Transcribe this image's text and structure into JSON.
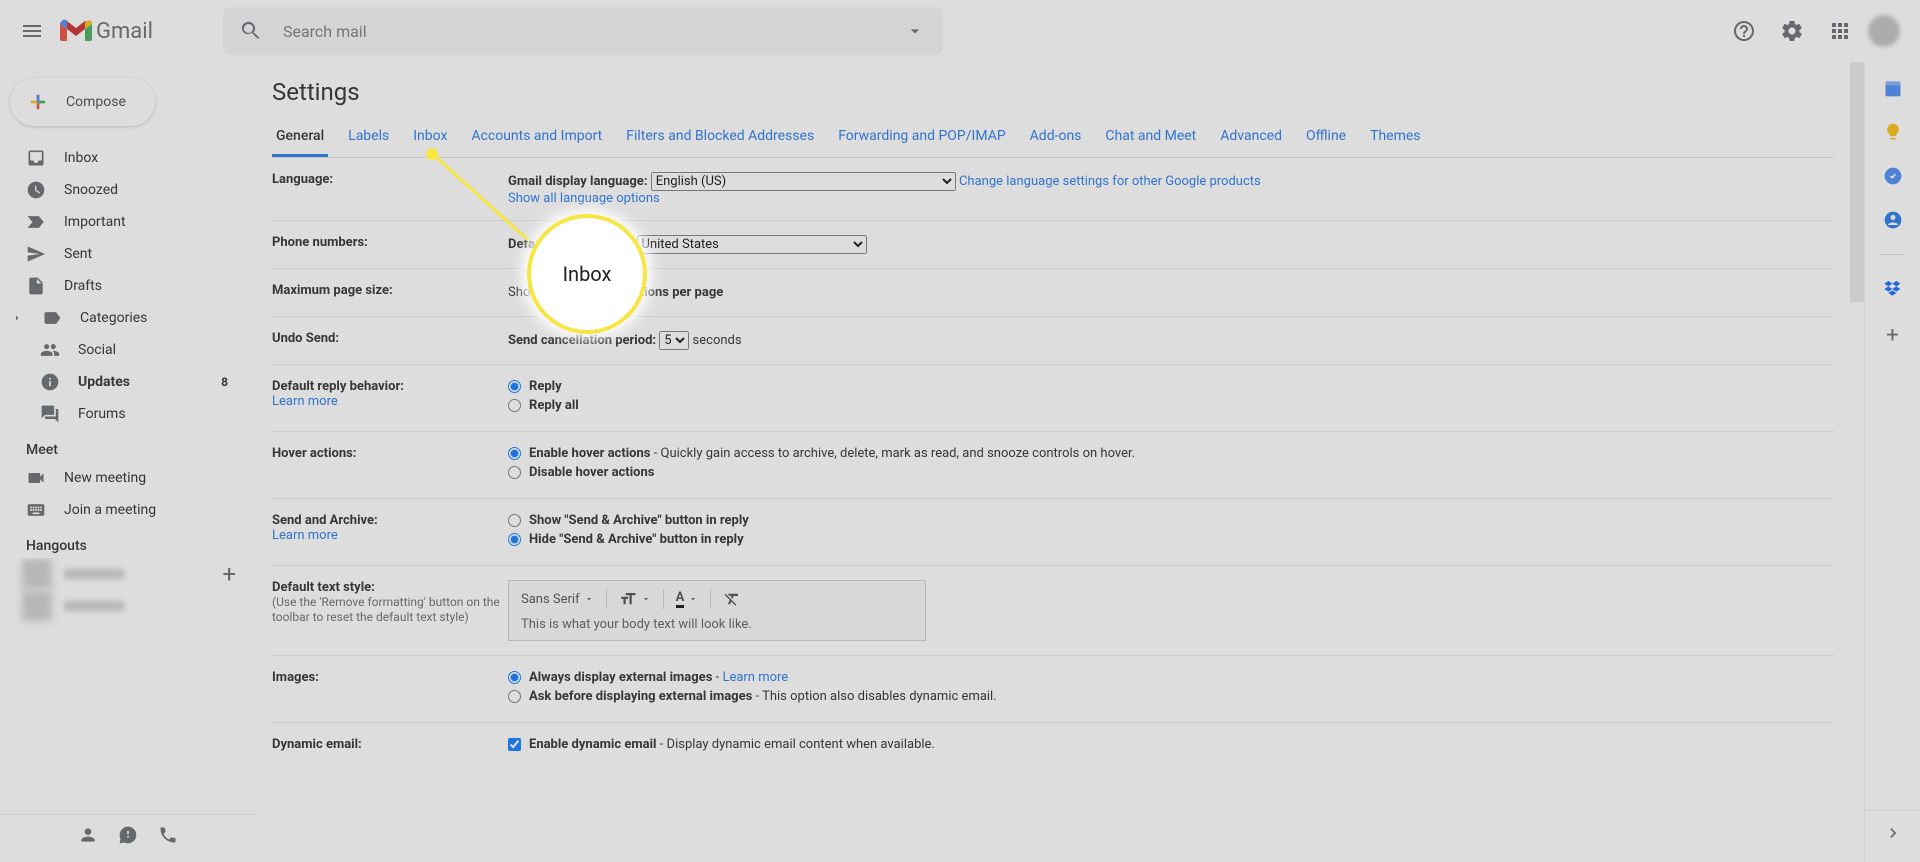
{
  "header": {
    "logo_text": "Gmail",
    "search_placeholder": "Search mail"
  },
  "sidebar": {
    "compose": "Compose",
    "items": [
      {
        "icon": "inbox",
        "label": "Inbox"
      },
      {
        "icon": "clock",
        "label": "Snoozed"
      },
      {
        "icon": "arrow-right",
        "label": "Important"
      },
      {
        "icon": "send",
        "label": "Sent"
      },
      {
        "icon": "file",
        "label": "Drafts"
      },
      {
        "icon": "label",
        "label": "Categories",
        "expand": true
      }
    ],
    "categories": [
      {
        "icon": "people",
        "label": "Social"
      },
      {
        "icon": "info",
        "label": "Updates",
        "count": "8",
        "bold": true
      },
      {
        "icon": "forum",
        "label": "Forums"
      }
    ],
    "meet_label": "Meet",
    "meet_items": [
      {
        "icon": "video",
        "label": "New meeting"
      },
      {
        "icon": "keyboard",
        "label": "Join a meeting"
      }
    ],
    "hangouts_label": "Hangouts"
  },
  "settings": {
    "title": "Settings",
    "tabs": [
      "General",
      "Labels",
      "Inbox",
      "Accounts and Import",
      "Filters and Blocked Addresses",
      "Forwarding and POP/IMAP",
      "Add-ons",
      "Chat and Meet",
      "Advanced",
      "Offline",
      "Themes"
    ],
    "active_tab_index": 0,
    "highlight_label": "Inbox",
    "rows": {
      "language": {
        "label": "Language:",
        "display_label": "Gmail display language:",
        "select_value": "English (US)",
        "change_link": "Change language settings for other Google products",
        "show_all": "Show all language options"
      },
      "phone": {
        "label": "Phone numbers:",
        "country_label": "Default country code:",
        "select_value": "United States"
      },
      "page_size": {
        "label": "Maximum page size:",
        "show": "Show",
        "per_page": "conversations per page"
      },
      "undo": {
        "label": "Undo Send:",
        "period_label": "Send cancellation period:",
        "value": "5",
        "seconds": "seconds"
      },
      "reply": {
        "label": "Default reply behavior:",
        "learn_more": "Learn more",
        "opt1": "Reply",
        "opt2": "Reply all"
      },
      "hover": {
        "label": "Hover actions:",
        "opt1": "Enable hover actions",
        "opt1_desc": " - Quickly gain access to archive, delete, mark as read, and snooze controls on hover.",
        "opt2": "Disable hover actions"
      },
      "archive": {
        "label": "Send and Archive:",
        "learn_more": "Learn more",
        "opt1": "Show \"Send & Archive\" button in reply",
        "opt2": "Hide \"Send & Archive\" button in reply"
      },
      "text_style": {
        "label": "Default text style:",
        "sub": "(Use the 'Remove formatting' button on the toolbar to reset the default text style)",
        "font": "Sans Serif",
        "sample": "This is what your body text will look like."
      },
      "images": {
        "label": "Images:",
        "opt1": "Always display external images",
        "learn_more": "Learn more",
        "opt2": "Ask before displaying external images",
        "opt2_desc": " - This option also disables dynamic email."
      },
      "dynamic": {
        "label": "Dynamic email:",
        "opt1": "Enable dynamic email",
        "desc": " - Display dynamic email content when available."
      }
    }
  },
  "right_panel": {
    "icons": [
      "calendar",
      "keep",
      "tasks",
      "contacts",
      "dropbox"
    ]
  }
}
